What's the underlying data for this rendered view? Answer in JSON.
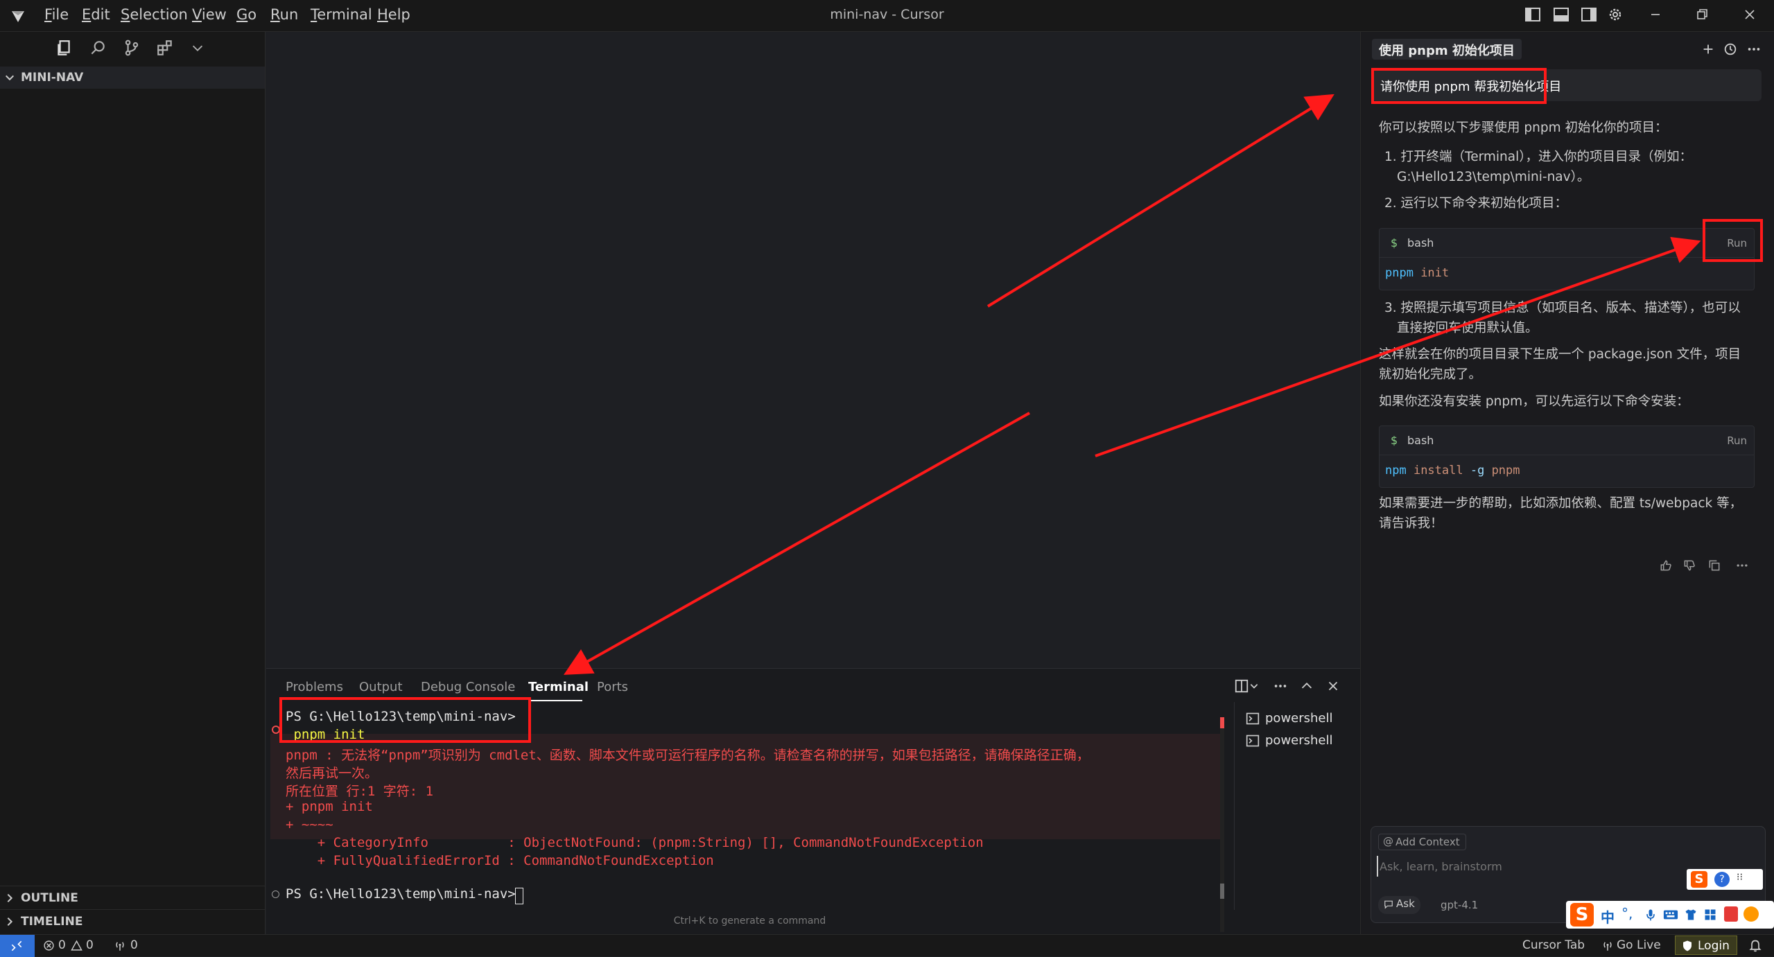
{
  "titlebar": {
    "menu": [
      {
        "label": "File",
        "ul": "F",
        "rest": "ile"
      },
      {
        "label": "Edit",
        "ul": "E",
        "rest": "dit"
      },
      {
        "label": "Selection",
        "ul": "S",
        "rest": "election"
      },
      {
        "label": "View",
        "ul": "V",
        "rest": "iew"
      },
      {
        "label": "Go",
        "ul": "G",
        "rest": "o"
      },
      {
        "label": "Run",
        "ul": "R",
        "rest": "un"
      },
      {
        "label": "Terminal",
        "ul": "T",
        "rest": "erminal"
      },
      {
        "label": "Help",
        "ul": "H",
        "rest": "elp"
      }
    ],
    "title": "mini-nav - Cursor"
  },
  "sidebar": {
    "folder": "MINI-NAV",
    "outline": "OUTLINE",
    "timeline": "TIMELINE"
  },
  "panel": {
    "tabs": [
      "Problems",
      "Output",
      "Debug Console",
      "Terminal",
      "Ports"
    ],
    "active_tab": "Terminal",
    "terminal_lines": {
      "prompt1": "PS G:\\Hello123\\temp\\mini-nav>",
      "cmd": " pnpm init",
      "err1": "pnpm : 无法将“pnpm”项识别为 cmdlet、函数、脚本文件或可运行程序的名称。请检查名称的拼写，如果包括路径，请确保路径正确，",
      "err2": "然后再试一次。",
      "err3": "所在位置 行:1 字符: 1",
      "err4": "+ pnpm init",
      "err5": "+ ~~~~",
      "err6": "    + CategoryInfo          : ObjectNotFound: (pnpm:String) [], CommandNotFoundException",
      "err7": "    + FullyQualifiedErrorId : CommandNotFoundException",
      "prompt2": "PS G:\\Hello123\\temp\\mini-nav> "
    },
    "terminal_list": [
      "powershell",
      "powershell"
    ],
    "hint": "Ctrl+K to generate a command"
  },
  "chat": {
    "title": "使用 pnpm 初始化项目",
    "user_message": "请你使用 pnpm 帮我初始化项目",
    "intro": "你可以按照以下步骤使用 pnpm 初始化你的项目：",
    "step1a": "1. 打开终端（Terminal），进入你的项目目录（例如：",
    "step1b": "G:\\Hello123\\temp\\mini-nav）。",
    "step2": "2. 运行以下命令来初始化项目：",
    "code1": {
      "lang": "bash",
      "run": "Run",
      "cmd": "pnpm",
      "args": " init"
    },
    "step3a": "3. 按照提示填写项目信息（如项目名、版本、描述等），也可以",
    "step3b": "直接按回车使用默认值。",
    "para1a": "这样就会在你的项目目录下生成一个 package.json 文件，项目",
    "para1b": "就初始化完成了。",
    "para2": "如果你还没有安装 pnpm，可以先运行以下命令安装：",
    "code2": {
      "lang": "bash",
      "run": "Run",
      "cmd": "npm",
      "args1": " install ",
      "flag": "-g",
      "args2": " pnpm"
    },
    "para3a": "如果需要进一步的帮助，比如添加依赖、配置 ts/webpack 等，",
    "para3b": "请告诉我！",
    "add_context": "Add Context",
    "input_placeholder": "Ask, learn, brainstorm",
    "mode": "Ask",
    "model": "gpt-4.1"
  },
  "statusbar": {
    "errors": "0",
    "warnings": "0",
    "ports": "0",
    "cursor_tab": "Cursor Tab",
    "go_live": "Go Live",
    "login": "Login"
  },
  "ime": {
    "zh": "中",
    "punct": "°,"
  }
}
